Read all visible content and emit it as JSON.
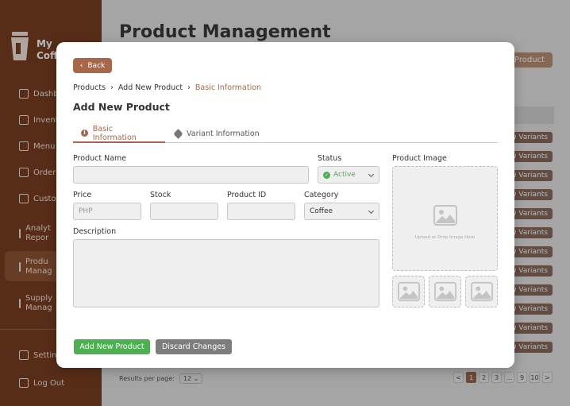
{
  "app": {
    "logo_text_line1": "My",
    "logo_text_line2": "Coff",
    "nav": [
      {
        "label": "Dashb"
      },
      {
        "label": "Invent"
      },
      {
        "label": "Menu"
      },
      {
        "label": "Orders"
      },
      {
        "label": "Custo"
      },
      {
        "label": "Analyt Repor"
      },
      {
        "label": "Produ Manag"
      },
      {
        "label": "Supply Manag"
      }
    ],
    "settings_label": "Settin",
    "logout_label": "Log Out",
    "page_title": "Product Management",
    "add_product_btn": "Product",
    "variant_btn_label": "w Variants",
    "results_per_page_label": "Results per page:",
    "results_per_page_value": "12",
    "pagination": [
      "<",
      "1",
      "2",
      "3",
      "...",
      "9",
      "10",
      ">"
    ]
  },
  "modal": {
    "back_label": "Back",
    "breadcrumb": [
      "Products",
      "Add New Product",
      "Basic Information"
    ],
    "title": "Add New Product",
    "tabs": [
      {
        "label": "Basic Information",
        "active": true,
        "icon": "info-icon"
      },
      {
        "label": "Variant Information",
        "active": false,
        "icon": "tag-icon"
      }
    ],
    "fields": {
      "product_name_label": "Product Name",
      "product_name_value": "",
      "status_label": "Status",
      "status_value": "Active",
      "price_label": "Price",
      "price_placeholder": "PHP",
      "stock_label": "Stock",
      "product_id_label": "Product ID",
      "category_label": "Category",
      "category_value": "Coffee",
      "description_label": "Description"
    },
    "image": {
      "label": "Product Image",
      "hint": "Upload or Drop Image Here"
    },
    "buttons": {
      "add": "Add New Product",
      "discard": "Discard Changes"
    },
    "colors": {
      "accent": "#a9674a",
      "success": "#4caf50",
      "neutral": "#7d7d7d"
    }
  }
}
